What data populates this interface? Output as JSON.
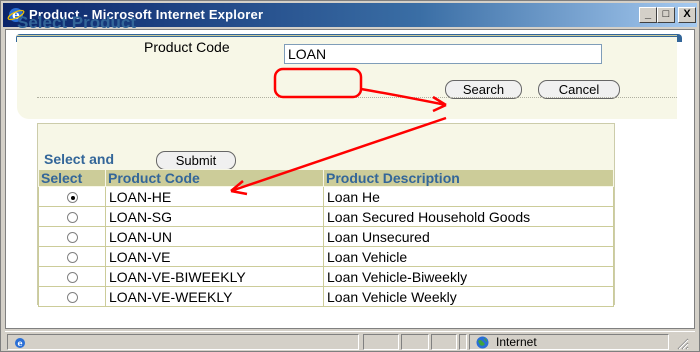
{
  "window": {
    "title": "Product - Microsoft Internet Explorer",
    "minimize": "_",
    "maximize": "□",
    "close": "X"
  },
  "page": {
    "title": "Select Product"
  },
  "search": {
    "product_code_label": "Product Code",
    "product_code_value": "LOAN",
    "search_label": "Search",
    "cancel_label": "Cancel"
  },
  "results": {
    "select_and_label": "Select and",
    "submit_label": "Submit",
    "headers": [
      "Select",
      "Product Code",
      "Product Description"
    ],
    "rows": [
      {
        "code": "LOAN-HE",
        "description": "Loan He",
        "selected": true
      },
      {
        "code": "LOAN-SG",
        "description": "Loan Secured Household Goods",
        "selected": false
      },
      {
        "code": "LOAN-UN",
        "description": "Loan Unsecured",
        "selected": false
      },
      {
        "code": "LOAN-VE",
        "description": "Loan Vehicle",
        "selected": false
      },
      {
        "code": "LOAN-VE-BIWEEKLY",
        "description": "Loan Vehicle-Biweekly",
        "selected": false
      },
      {
        "code": "LOAN-VE-WEEKLY",
        "description": "Loan Vehicle Weekly",
        "selected": false
      }
    ]
  },
  "statusbar": {
    "zone": "Internet"
  },
  "colors": {
    "accent": "#336699",
    "annotation": "#ff0000",
    "header_bg": "#cccc99",
    "panel_bg": "#f7f7e7"
  },
  "icons": {
    "app": "ie-icon",
    "status_page": "ie-page-icon",
    "zone": "globe-icon",
    "resize": "resize-grip-icon"
  }
}
